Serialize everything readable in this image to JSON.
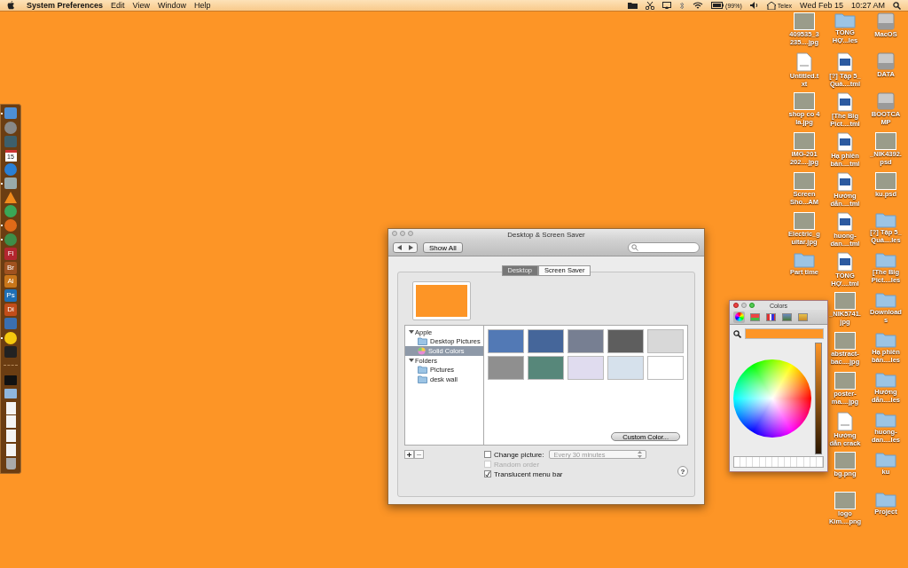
{
  "menu_bar": {
    "app_name": "System Preferences",
    "menus": [
      "Edit",
      "View",
      "Window",
      "Help"
    ],
    "battery": "(99%)",
    "input_source": "Telex",
    "date": "Wed Feb 15",
    "time": "10:27 AM"
  },
  "dock": [
    {
      "kind": "finder",
      "running": true
    },
    {
      "kind": "rocket",
      "running": false
    },
    {
      "kind": "dashboard",
      "running": false
    },
    {
      "kind": "calendar",
      "label": "15",
      "running": false
    },
    {
      "kind": "music",
      "running": false
    },
    {
      "kind": "gear",
      "running": true
    },
    {
      "kind": "cone",
      "running": false
    },
    {
      "kind": "chrome",
      "running": false
    },
    {
      "kind": "firefox",
      "running": true
    },
    {
      "kind": "globe",
      "running": true
    },
    {
      "kind": "app",
      "label": "Fl",
      "running": false
    },
    {
      "kind": "app",
      "label": "Br",
      "running": false
    },
    {
      "kind": "app",
      "label": "Ai",
      "running": false
    },
    {
      "kind": "app",
      "label": "Ps",
      "running": false
    },
    {
      "kind": "app",
      "label": "Di",
      "running": false
    },
    {
      "kind": "printer",
      "running": false
    },
    {
      "kind": "smiley",
      "running": true
    },
    {
      "kind": "phone",
      "running": false
    },
    {
      "kind": "separator",
      "running": false
    },
    {
      "kind": "stack",
      "running": false
    },
    {
      "kind": "folder",
      "running": false
    },
    {
      "kind": "document",
      "running": false
    },
    {
      "kind": "document",
      "running": false
    },
    {
      "kind": "image",
      "running": false
    },
    {
      "kind": "image",
      "running": false
    },
    {
      "kind": "trash",
      "running": false
    }
  ],
  "desktop_icons": [
    [
      {
        "kind": "image",
        "label": "409535_3\n235....jpg"
      },
      {
        "kind": "text",
        "label": "Untitled.t\nxt"
      },
      {
        "kind": "image",
        "label": "shop co 4\nla.jpg"
      },
      {
        "kind": "image",
        "label": "IMG-201\n202....jpg"
      },
      {
        "kind": "image",
        "label": "Screen\nSho...AM"
      },
      {
        "kind": "image",
        "label": "Electric_g\nuitar.jpg"
      },
      {
        "kind": "folder",
        "label": "Part time"
      }
    ],
    [
      {
        "kind": "folder",
        "label": "TỔNG\nHỢ...les"
      },
      {
        "kind": "html",
        "label": "[?] Tập 5_\nQuả....tml"
      },
      {
        "kind": "html",
        "label": "[The Big\nPict....tml"
      },
      {
        "kind": "html",
        "label": "Hạ phiên\nbản....tml"
      },
      {
        "kind": "html",
        "label": "Hướng\ndẫn....tml"
      },
      {
        "kind": "html",
        "label": "huong-\ndan....tml"
      },
      {
        "kind": "html",
        "label": "TỔNG\nHỢ....tml"
      },
      {
        "kind": "image",
        "label": "_NIK5741.\njpg"
      },
      {
        "kind": "image",
        "label": "abstract-\nbac....jpg"
      },
      {
        "kind": "image",
        "label": "poster-\nma....jpg"
      },
      {
        "kind": "text",
        "label": "Hướng\ndẫn crack"
      },
      {
        "kind": "image",
        "label": "bg.png"
      },
      {
        "kind": "image",
        "label": "logo\nKim....png"
      }
    ],
    [
      {
        "kind": "drive",
        "label": "MacOS"
      },
      {
        "kind": "drive",
        "label": "DATA"
      },
      {
        "kind": "drive",
        "label": "BOOTCA\nMP"
      },
      {
        "kind": "image",
        "label": "_NIK4392.\npsd"
      },
      {
        "kind": "image",
        "label": "ku.psd"
      },
      {
        "kind": "folder",
        "label": "[?] Tập 5_\nQuả....les"
      },
      {
        "kind": "folder",
        "label": "[The Big\nPict....les"
      },
      {
        "kind": "folder",
        "label": "Download\ns"
      },
      {
        "kind": "folder",
        "label": "Hạ phiên\nbản....les"
      },
      {
        "kind": "folder",
        "label": "Hướng\ndẫn....les"
      },
      {
        "kind": "folder",
        "label": "huong-\ndan....les"
      },
      {
        "kind": "folder",
        "label": "ku"
      },
      {
        "kind": "folder",
        "label": "Project"
      }
    ]
  ],
  "window": {
    "title": "Desktop & Screen Saver",
    "show_all": "Show All",
    "tabs": [
      {
        "label": "Desktop",
        "selected": true
      },
      {
        "label": "Screen Saver",
        "selected": false
      }
    ],
    "sources": [
      {
        "label": "Apple",
        "expanded": true,
        "children": [
          {
            "label": "Desktop Pictures",
            "kind": "folder",
            "selected": false
          },
          {
            "label": "Solid Colors",
            "kind": "colors",
            "selected": true
          }
        ]
      },
      {
        "label": "Folders",
        "expanded": true,
        "children": [
          {
            "label": "Pictures",
            "kind": "folder",
            "selected": false
          },
          {
            "label": "desk wall",
            "kind": "folder",
            "selected": false
          }
        ]
      }
    ],
    "swatches": [
      {
        "color": "#5279b5"
      },
      {
        "color": "#45669a"
      },
      {
        "color": "#777f92"
      },
      {
        "color": "#5e5e5e"
      },
      {
        "color": "#d8d8d8"
      },
      {
        "color": "#8f8f8f"
      },
      {
        "color": "#57877a"
      },
      {
        "color": "#e0dcef"
      },
      {
        "color": "#d6e1ec"
      },
      {
        "color": "#ffffff"
      }
    ],
    "custom_color": "Custom Color...",
    "options": [
      {
        "label": "Change picture:",
        "checked": false,
        "disabled": false
      },
      {
        "label": "Random order",
        "checked": false,
        "disabled": true
      },
      {
        "label": "Translucent menu bar",
        "checked": true,
        "disabled": false
      }
    ],
    "interval": {
      "value": "Every 30 minutes",
      "disabled": true
    },
    "help": "?"
  },
  "colors_panel": {
    "title": "Colors",
    "brightness": {
      "level": 1
    }
  }
}
